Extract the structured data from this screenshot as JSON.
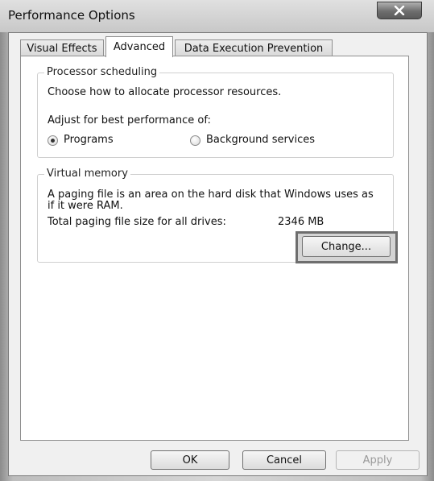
{
  "window": {
    "title": "Performance Options",
    "close_label": "×"
  },
  "tabs": [
    {
      "label": "Visual Effects",
      "active": false
    },
    {
      "label": "Advanced",
      "active": true
    },
    {
      "label": "Data Execution Prevention",
      "active": false
    }
  ],
  "processor_scheduling": {
    "legend": "Processor scheduling",
    "description": "Choose how to allocate processor resources.",
    "adjust_label": "Adjust for best performance of:",
    "options": [
      {
        "label": "Programs",
        "selected": true
      },
      {
        "label": "Background services",
        "selected": false
      }
    ]
  },
  "virtual_memory": {
    "legend": "Virtual memory",
    "description_line1": "A paging file is an area on the hard disk that Windows uses as",
    "description_line2": "if it were RAM.",
    "total_label": "Total paging file size for all drives:",
    "total_value": "2346 MB",
    "change_button": "Change..."
  },
  "buttons": {
    "ok": "OK",
    "cancel": "Cancel",
    "apply": "Apply"
  }
}
